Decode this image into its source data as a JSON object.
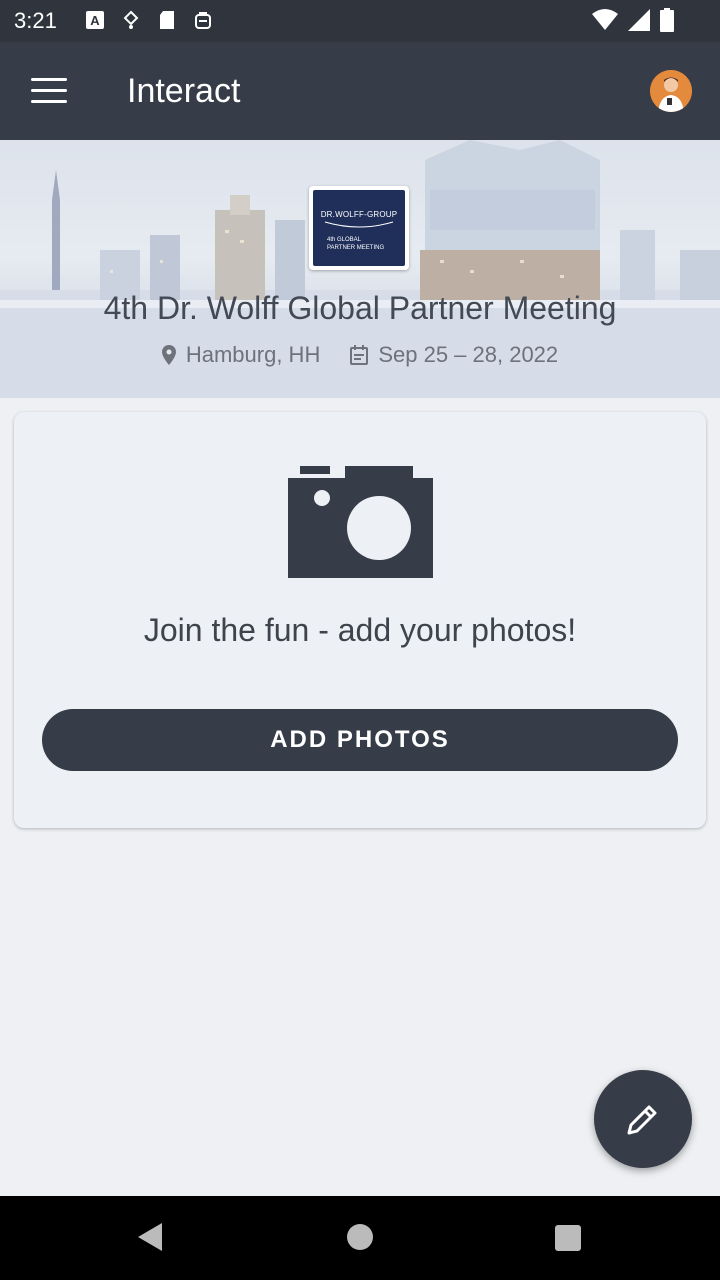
{
  "status_bar": {
    "time": "3:21",
    "left_icons": [
      "accessibility-a-icon",
      "sync-icon",
      "sd-card-icon",
      "shopping-bag-icon"
    ],
    "right_icons": [
      "wifi-icon",
      "signal-icon",
      "battery-icon"
    ]
  },
  "app_bar": {
    "title": "Interact",
    "menu_icon": "hamburger-menu-icon",
    "avatar": "user-avatar"
  },
  "event": {
    "logo_brand": "DR.WOLFF-GROUP",
    "logo_line1": "4th GLOBAL",
    "logo_line2": "PARTNER MEETING",
    "title": "4th Dr. Wolff Global Partner Meeting",
    "location": "Hamburg, HH",
    "dates": "Sep 25 – 28, 2022"
  },
  "photos_card": {
    "message": "Join the fun - add your photos!",
    "button_label": "ADD PHOTOS",
    "icon": "camera-icon"
  },
  "fab": {
    "icon": "pencil-edit-icon"
  },
  "colors": {
    "app_bar": "#363c48",
    "status_bar": "#2f343d",
    "background": "#eef0f3",
    "button": "#363c48"
  }
}
